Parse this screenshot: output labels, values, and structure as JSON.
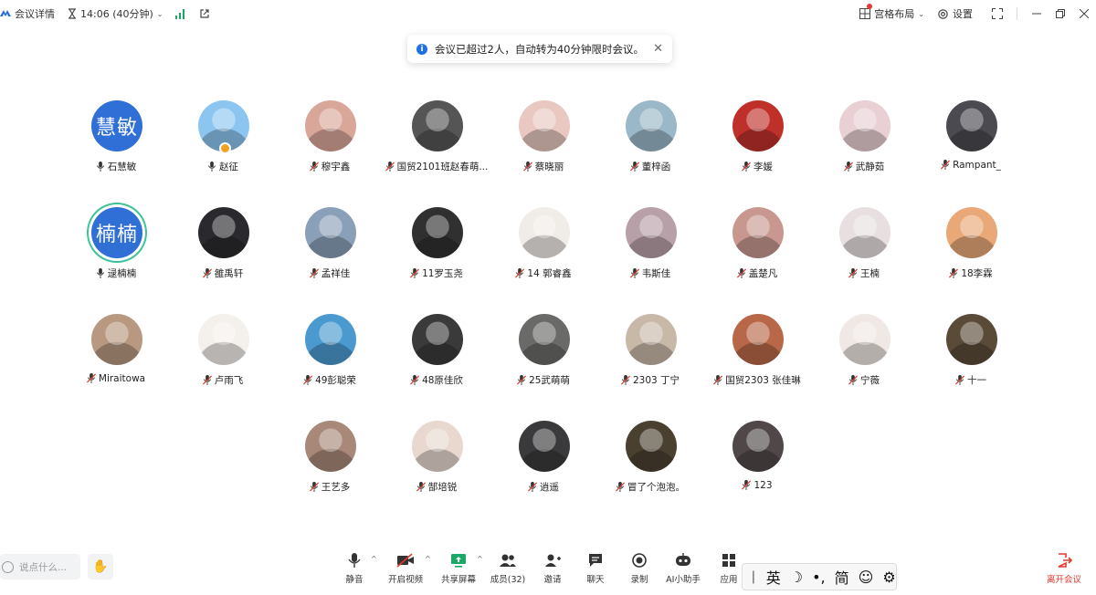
{
  "topbar": {
    "meeting_details": "会议详情",
    "time": "14:06 (40分钟)",
    "layout": "宫格布局",
    "settings": "设置"
  },
  "toast": {
    "message": "会议已超过2人，自动转为40分钟限时会议。"
  },
  "participants": [
    {
      "name": "石慧敏",
      "avatar_text": "慧敏",
      "avatar_color": "#2f6fd6",
      "muted": false
    },
    {
      "name": "赵征",
      "avatar_color": "#8cc6f0",
      "muted": false,
      "host": true
    },
    {
      "name": "穆宇鑫",
      "avatar_color": "#d9a79a",
      "muted": true
    },
    {
      "name": "国贸2101班赵春萌...",
      "avatar_color": "#555555",
      "muted": true
    },
    {
      "name": "蔡晓丽",
      "avatar_color": "#e8c8c0",
      "muted": true
    },
    {
      "name": "董梓函",
      "avatar_color": "#9ab8c8",
      "muted": true
    },
    {
      "name": "李媛",
      "avatar_color": "#c0302a",
      "muted": true
    },
    {
      "name": "武静茹",
      "avatar_color": "#e8d0d4",
      "muted": true
    },
    {
      "name": "Rampant_",
      "avatar_color": "#4a4a50",
      "muted": true
    },
    {
      "name": "逯楠楠",
      "avatar_text": "楠楠",
      "avatar_color": "#2f6fd6",
      "muted": false,
      "speaking": true
    },
    {
      "name": "雒禹轩",
      "avatar_color": "#2a2a2e",
      "muted": true
    },
    {
      "name": "孟祥佳",
      "avatar_color": "#8aa0b8",
      "muted": true
    },
    {
      "name": "11罗玉尧",
      "avatar_color": "#303030",
      "muted": true
    },
    {
      "name": "14 郭睿鑫",
      "avatar_color": "#f0ece8",
      "muted": true
    },
    {
      "name": "韦斯佳",
      "avatar_color": "#b8a0a8",
      "muted": true
    },
    {
      "name": "盖楚凡",
      "avatar_color": "#c89890",
      "muted": true
    },
    {
      "name": "王楠",
      "avatar_color": "#e8e0e0",
      "muted": true
    },
    {
      "name": "18李霖",
      "avatar_color": "#e8a878",
      "muted": true
    },
    {
      "name": "Miraitowa",
      "avatar_color": "#b89880",
      "muted": true
    },
    {
      "name": "卢雨飞",
      "avatar_color": "#f4f0ec",
      "muted": true
    },
    {
      "name": "49彭聪荣",
      "avatar_color": "#4a9ad0",
      "muted": true
    },
    {
      "name": "48原佳欣",
      "avatar_color": "#3a3a3a",
      "muted": true
    },
    {
      "name": "25武萌萌",
      "avatar_color": "#6a6a68",
      "muted": true
    },
    {
      "name": "2303 丁宁",
      "avatar_color": "#c8b8a8",
      "muted": true
    },
    {
      "name": "国贸2303 张佳琳",
      "avatar_color": "#b86848",
      "muted": true
    },
    {
      "name": "宁薇",
      "avatar_color": "#f0e8e4",
      "muted": true
    },
    {
      "name": "十一",
      "avatar_color": "#5a4a38",
      "muted": true
    },
    {
      "name": "王艺多",
      "avatar_color": "#a88878",
      "muted": true
    },
    {
      "name": "郜培锐",
      "avatar_color": "#e8d8d0",
      "muted": true
    },
    {
      "name": "逍遥",
      "avatar_color": "#3a3a3c",
      "muted": true
    },
    {
      "name": "冒了个泡泡。",
      "avatar_color": "#4a4030",
      "muted": true
    },
    {
      "name": "123",
      "avatar_color": "#504848",
      "muted": true
    }
  ],
  "bottombar": {
    "chat_placeholder": "说点什么...",
    "controls": [
      {
        "label": "静音",
        "icon": "mic-icon"
      },
      {
        "label": "开启视频",
        "icon": "video-off-icon"
      },
      {
        "label": "共享屏幕",
        "icon": "screen-share-icon",
        "color": "#1aa867"
      },
      {
        "label": "成员(32)",
        "icon": "members-icon"
      },
      {
        "label": "邀请",
        "icon": "invite-icon"
      },
      {
        "label": "聊天",
        "icon": "chat-icon"
      },
      {
        "label": "录制",
        "icon": "record-icon"
      },
      {
        "label": "AI小助手",
        "icon": "ai-assistant-icon"
      },
      {
        "label": "应用",
        "icon": "apps-icon"
      }
    ],
    "leave_label": "离开会议",
    "leave_color": "#e0392b"
  },
  "ime": {
    "lang": "英",
    "mode": "简"
  }
}
